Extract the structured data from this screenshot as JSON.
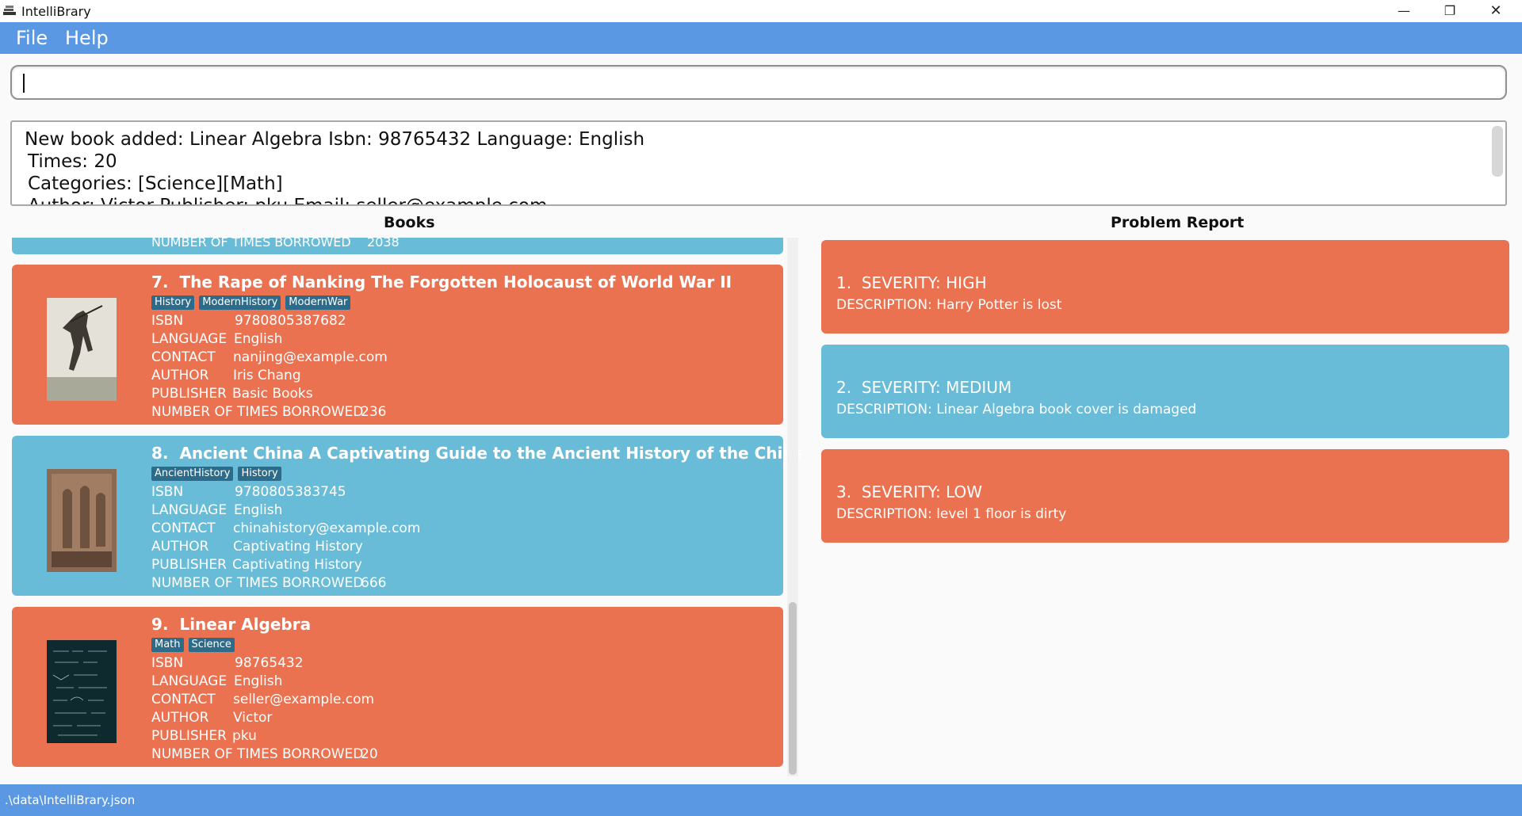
{
  "window": {
    "title": "IntelliBrary",
    "minimize_glyph": "—",
    "maximize_glyph": "❐",
    "close_glyph": "✕"
  },
  "menu": {
    "file": "File",
    "help": "Help"
  },
  "command": {
    "value": ""
  },
  "result": {
    "lines": [
      "New book added: Linear Algebra Isbn: 98765432 Language: English",
      "Times: 20",
      "Categories: [Science][Math]",
      "Author: Victor Publisher: pku Email: seller@example.com"
    ]
  },
  "panels": {
    "books_header": "Books",
    "problems_header": "Problem Report"
  },
  "labels": {
    "isbn": "ISBN",
    "language": "LANGUAGE",
    "contact": "CONTACT",
    "author": "AUTHOR",
    "publisher": "PUBLISHER",
    "times_borrowed": "NUMBER OF TIMES BORROWED"
  },
  "partial_card": {
    "label": "NUMBER OF TIMES BORROWED",
    "value": "2038"
  },
  "books": [
    {
      "index": "7.",
      "title": "The Rape of Nanking The Forgotten Holocaust of World War II",
      "tags": [
        "History",
        "ModernHistory",
        "ModernWar"
      ],
      "isbn": "9780805387682",
      "language": "English",
      "contact": "nanjing@example.com",
      "author": "Iris Chang",
      "publisher": "Basic Books",
      "times": "236",
      "color": "#eb7250",
      "cover": "soldier-photo"
    },
    {
      "index": "8.",
      "title": "Ancient China A Captivating Guide to the Ancient History of the Chinese Civilization",
      "tags": [
        "AncientHistory",
        "History"
      ],
      "isbn": "9780805383745",
      "language": "English",
      "contact": "chinahistory@example.com",
      "author": "Captivating History",
      "publisher": "Captivating History",
      "times": "666",
      "color": "#69bcd7",
      "cover": "stone-relief"
    },
    {
      "index": "9.",
      "title": "Linear Algebra",
      "tags": [
        "Math",
        "Science"
      ],
      "isbn": "98765432",
      "language": "English",
      "contact": "seller@example.com",
      "author": "Victor",
      "publisher": "pku",
      "times": "20",
      "color": "#eb7250",
      "cover": "chalkboard-equations"
    }
  ],
  "problems": [
    {
      "index": "1.",
      "severity": "SEVERITY: HIGH",
      "description": "DESCRIPTION: Harry Potter is lost",
      "color": "#eb7250"
    },
    {
      "index": "2.",
      "severity": "SEVERITY: MEDIUM",
      "description": "DESCRIPTION: Linear Algebra book cover is damaged",
      "color": "#69bcd7"
    },
    {
      "index": "3.",
      "severity": "SEVERITY: LOW",
      "description": "DESCRIPTION: level 1 floor is dirty",
      "color": "#eb7250"
    }
  ],
  "status": {
    "path": ".\\data\\IntelliBrary.json"
  }
}
